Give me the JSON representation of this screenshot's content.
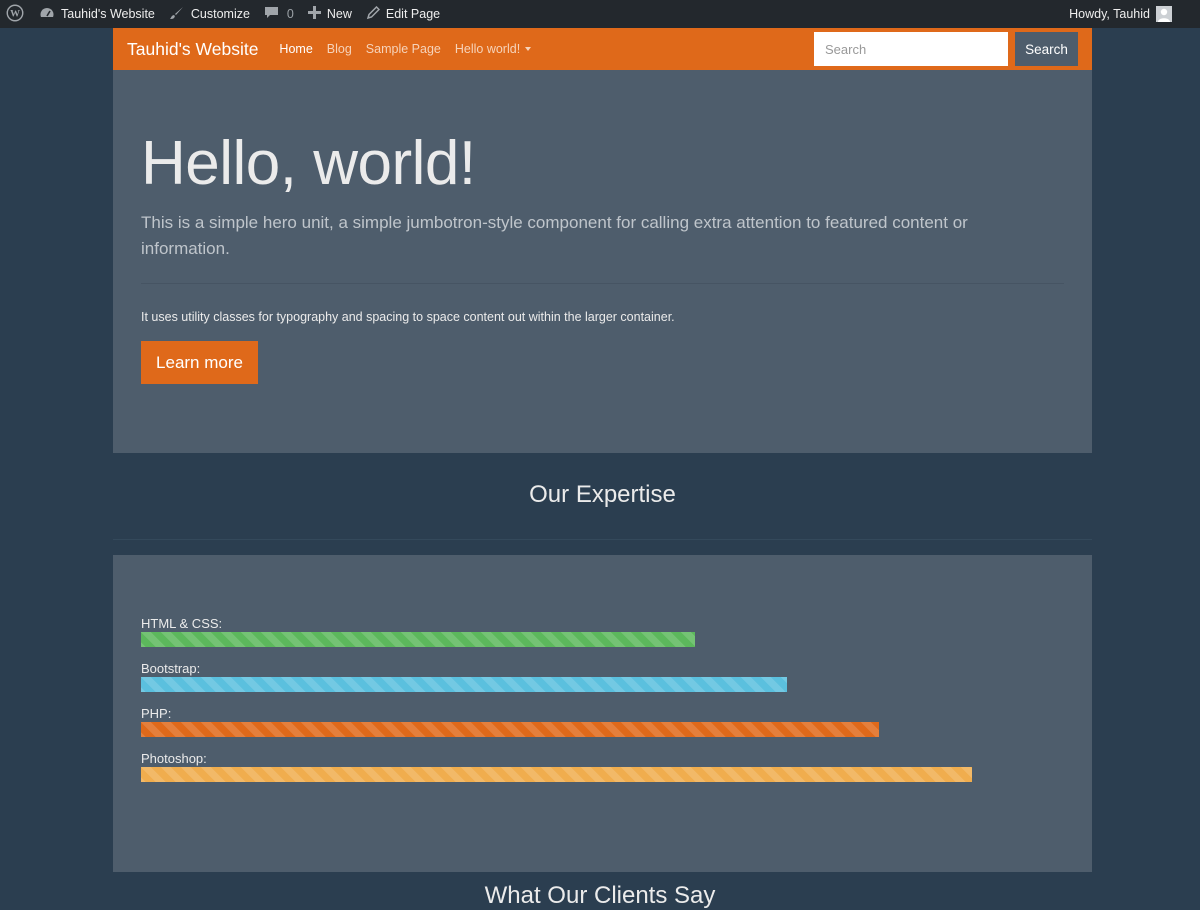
{
  "admin_bar": {
    "site_name": "Tauhid's Website",
    "customize": "Customize",
    "comments_count": "0",
    "new": "New",
    "edit_page": "Edit Page",
    "howdy": "Howdy, Tauhid"
  },
  "navbar": {
    "brand": "Tauhid's Website",
    "links": [
      "Home",
      "Blog",
      "Sample Page",
      "Hello world!"
    ],
    "active_link": "Home",
    "search_placeholder": "Search",
    "search_button": "Search",
    "accent_color": "#df691a"
  },
  "hero": {
    "title": "Hello, world!",
    "lead": "This is a simple hero unit, a simple jumbotron-style component for calling extra attention to featured content or information.",
    "text": "It uses utility classes for typography and spacing to space content out within the larger container.",
    "button": "Learn more"
  },
  "expertise": {
    "title": "Our Expertise",
    "skills": [
      {
        "label": "HTML & CSS:",
        "percent": 60,
        "color": "#5cb85c"
      },
      {
        "label": "Bootstrap:",
        "percent": 70,
        "color": "#5bc0de"
      },
      {
        "label": "PHP:",
        "percent": 80,
        "color": "#df691a"
      },
      {
        "label": "Photoshop:",
        "percent": 90,
        "color": "#f0ad4e"
      }
    ]
  },
  "clients": {
    "title": "What Our Clients Say"
  }
}
